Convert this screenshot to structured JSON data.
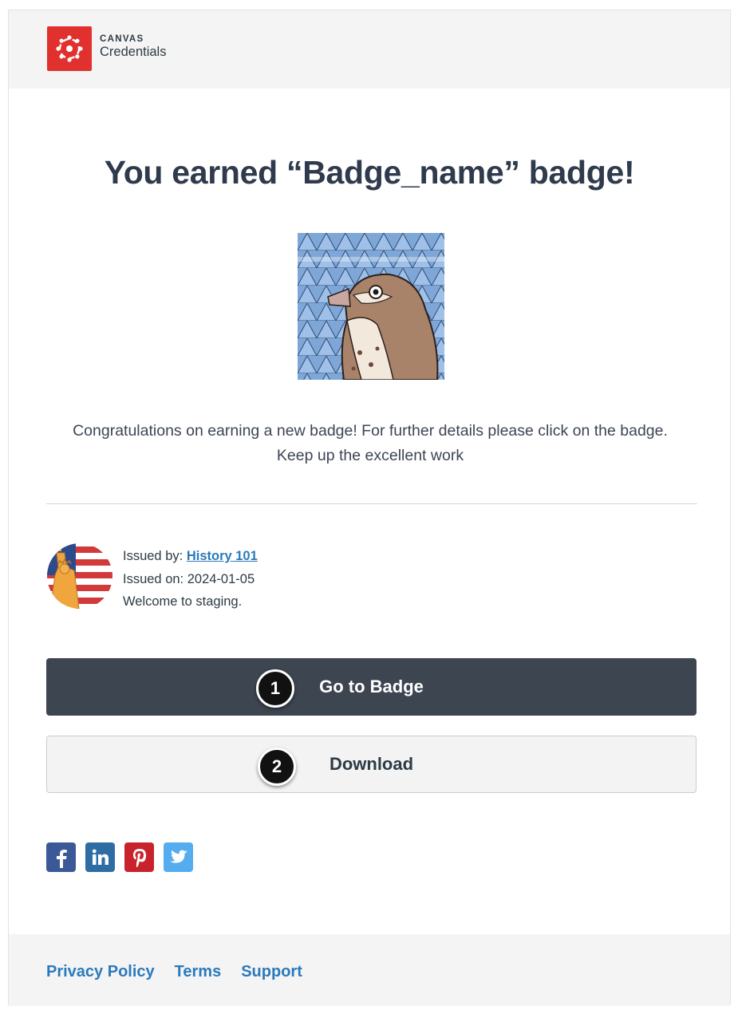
{
  "header": {
    "logo_line1": "CANVAS",
    "logo_line2": "Credentials",
    "logo_color": "#e0312e"
  },
  "main": {
    "title": "You earned “Badge_name” badge!",
    "badge_image_icon": "sparrow-badge-image",
    "congrats_line1": "Congratulations on earning a new badge! For further details please click on the badge.",
    "congrats_line2": "Keep up the excellent work"
  },
  "issuer": {
    "avatar_icon": "statue-of-liberty-flag-avatar",
    "issued_by_label": "Issued by:",
    "issued_by_link": "History 101",
    "issued_on_label": "Issued on:",
    "issued_on_value": "2024-01-05",
    "message": "Welcome to staging."
  },
  "actions": {
    "go_to_badge": "Go to Badge",
    "download": "Download",
    "callout_1": "1",
    "callout_2": "2"
  },
  "social": [
    {
      "name": "facebook-icon",
      "color": "#3b5998"
    },
    {
      "name": "linkedin-icon",
      "color": "#2e6da4"
    },
    {
      "name": "pinterest-icon",
      "color": "#c8232c"
    },
    {
      "name": "twitter-icon",
      "color": "#55acee"
    }
  ],
  "footer": {
    "privacy": "Privacy Policy",
    "terms": "Terms",
    "support": "Support"
  },
  "colors": {
    "primary_button": "#3d4551",
    "link": "#2b7abc"
  }
}
